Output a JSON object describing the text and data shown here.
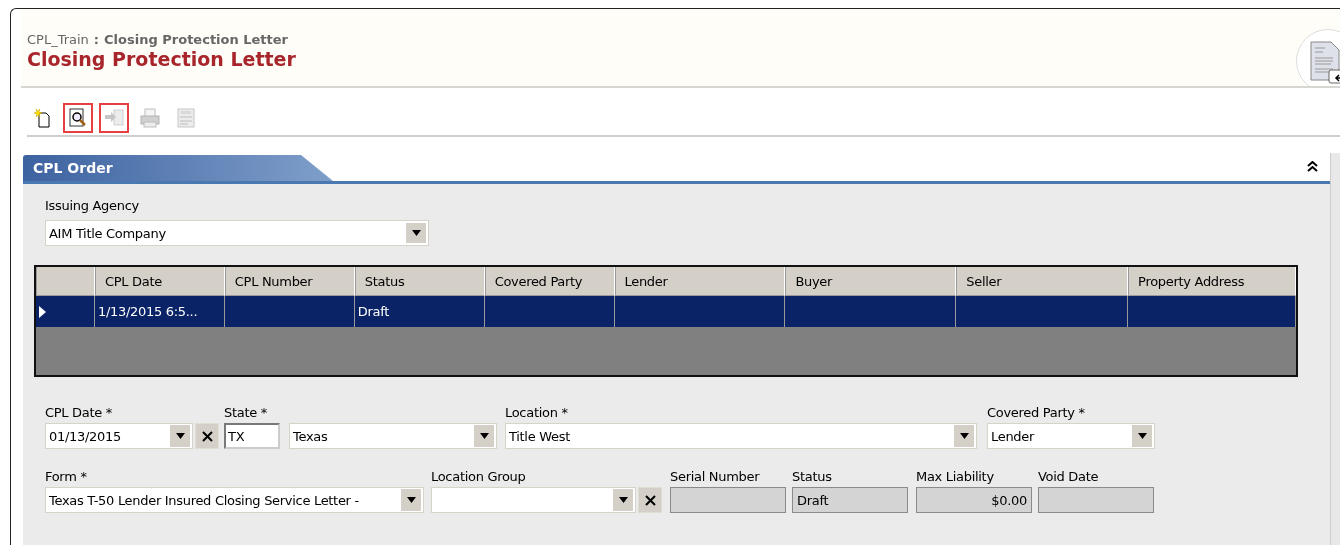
{
  "header": {
    "breadcrumb_app": "CPL_Train",
    "breadcrumb_separator": ":",
    "breadcrumb_page": "Closing Protection Letter",
    "title": "Closing Protection Letter"
  },
  "toolbar": [
    {
      "kind": "new",
      "highlighted": false,
      "disabled": false
    },
    {
      "kind": "preview",
      "highlighted": true,
      "disabled": false
    },
    {
      "kind": "import",
      "highlighted": true,
      "disabled": true
    },
    {
      "kind": "print",
      "highlighted": false,
      "disabled": true
    },
    {
      "kind": "void",
      "highlighted": false,
      "disabled": true
    }
  ],
  "section": {
    "title": "CPL Order",
    "expanded": true
  },
  "issuing_agency": {
    "label": "Issuing Agency",
    "value": "AIM Title Company"
  },
  "grid": {
    "columns": [
      "CPL Date",
      "CPL Number",
      "Status",
      "Covered Party",
      "Lender",
      "Buyer",
      "Seller",
      "Property Address"
    ],
    "rows": [
      {
        "selected": true,
        "cpl_date": "1/13/2015 6:5...",
        "status": "Draft"
      }
    ]
  },
  "form_rows": [
    [
      {
        "label": "CPL Date *",
        "kind": "date",
        "value": "01/13/2015"
      },
      {
        "label": "State *",
        "kind": "code",
        "value": "TX"
      },
      {
        "kind": "select",
        "value": "Texas"
      },
      {
        "label": "Location *",
        "kind": "select",
        "value": "Title West"
      },
      {
        "label": "Covered Party *",
        "kind": "select",
        "value": "Lender"
      }
    ],
    [
      {
        "label": "Form *",
        "kind": "select",
        "value": "Texas T-50 Lender Insured Closing Service Letter -"
      },
      {
        "label": "Location Group",
        "kind": "clearable-select"
      },
      {
        "label": "Serial Number",
        "kind": "readonly"
      },
      {
        "label": "Status",
        "kind": "readonly",
        "value": "Draft"
      },
      {
        "label": "Max Liability",
        "kind": "readonly-amount",
        "value": "$0.00"
      },
      {
        "label": "Void Date",
        "kind": "readonly"
      }
    ]
  ]
}
